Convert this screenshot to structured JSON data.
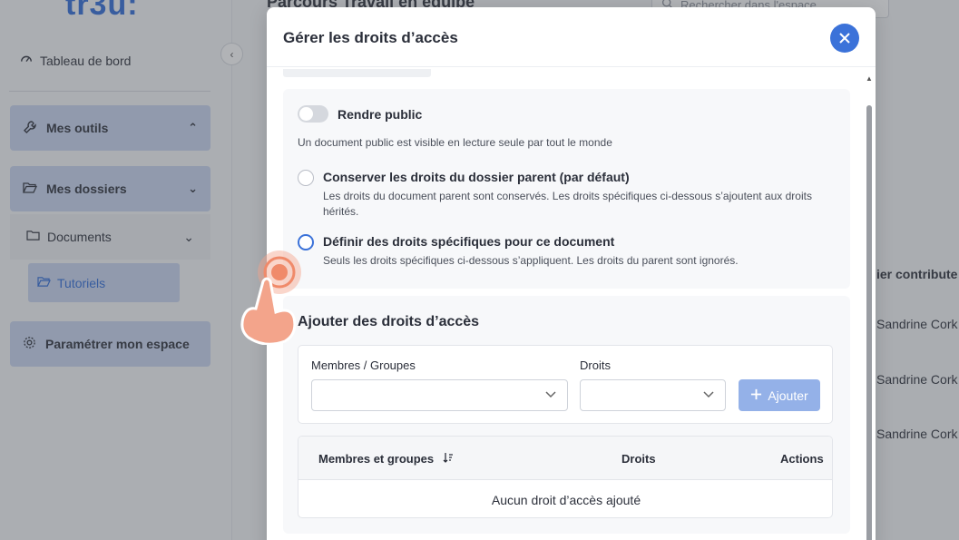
{
  "app": {
    "logo": "tr3u:",
    "dashboard": "Tableau de bord",
    "tools": "Mes outils",
    "folders": "Mes dossiers",
    "documents": "Documents",
    "tutorials": "Tutoriels",
    "settings": "Paramétrer mon espace",
    "page_title": "Parcours Travail en équipe",
    "search_placeholder": "Rechercher dans l'espace",
    "column_header": "ier contribute",
    "names": [
      "Sandrine Cork",
      "Sandrine Cork",
      "Sandrine Cork"
    ]
  },
  "modal": {
    "title": "Gérer les droits d’accès",
    "public_toggle_label": "Rendre public",
    "public_toggle_on": false,
    "public_hint": "Un document public est visible en lecture seule par tout le monde",
    "option_parent_title": "Conserver les droits du dossier parent (par défaut)",
    "option_parent_desc": "Les droits du document parent sont conservés. Les droits spécifiques ci-dessous s’ajoutent aux droits hérités.",
    "option_specific_title": "Définir des droits spécifiques pour ce document",
    "option_specific_desc": "Seuls les droits spécifiques ci-dessous s’appliquent. Les droits du parent sont ignorés.",
    "selected_option": "specific",
    "add_section_title": "Ajouter des droits d’accès",
    "members_label": "Membres / Groupes",
    "members_value": "",
    "rights_label": "Droits",
    "rights_value": "",
    "add_button": "Ajouter",
    "table_headers": {
      "members": "Membres et groupes",
      "rights": "Droits",
      "actions": "Actions"
    },
    "empty_text": "Aucun droit d’accès ajouté"
  },
  "colors": {
    "accent": "#3b72d9",
    "add_button_disabled": "#94b1e8",
    "tap_indicator": "#f08a6a"
  }
}
